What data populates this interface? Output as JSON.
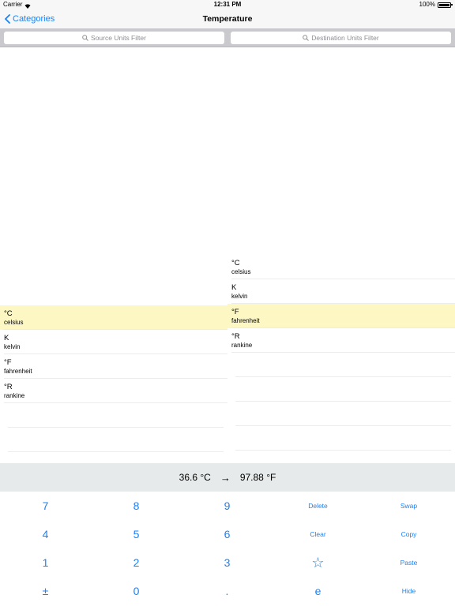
{
  "status_bar": {
    "carrier": "Carrier",
    "time": "12:31 PM",
    "battery": "100%"
  },
  "nav": {
    "back_label": "Categories",
    "title": "Temperature"
  },
  "search": {
    "source_placeholder": "Source Units Filter",
    "destination_placeholder": "Destination Units Filter"
  },
  "source_units": [
    {
      "symbol": "°C",
      "name": "celsius",
      "selected": true
    },
    {
      "symbol": "K",
      "name": "kelvin",
      "selected": false
    },
    {
      "symbol": "°F",
      "name": "fahrenheit",
      "selected": false
    },
    {
      "symbol": "°R",
      "name": "rankine",
      "selected": false
    }
  ],
  "destination_units": [
    {
      "symbol": "°C",
      "name": "celsius",
      "selected": false
    },
    {
      "symbol": "K",
      "name": "kelvin",
      "selected": false
    },
    {
      "symbol": "°F",
      "name": "fahrenheit",
      "selected": true
    },
    {
      "symbol": "°R",
      "name": "rankine",
      "selected": false
    }
  ],
  "result": {
    "source_value": "36.6 °C",
    "arrow": "→",
    "destination_value": "97.88 °F"
  },
  "keypad": {
    "rows": [
      [
        "7",
        "8",
        "9",
        "Delete",
        "Swap"
      ],
      [
        "4",
        "5",
        "6",
        "Clear",
        "Copy"
      ],
      [
        "1",
        "2",
        "3",
        "☆",
        "Paste"
      ],
      [
        "±",
        "0",
        ".",
        "e",
        "Hide"
      ]
    ]
  },
  "colors": {
    "accent": "#1a82f7",
    "selected_row": "#fdf7c3",
    "result_bar": "#e7eaea",
    "search_strip": "#c9c9ce"
  }
}
